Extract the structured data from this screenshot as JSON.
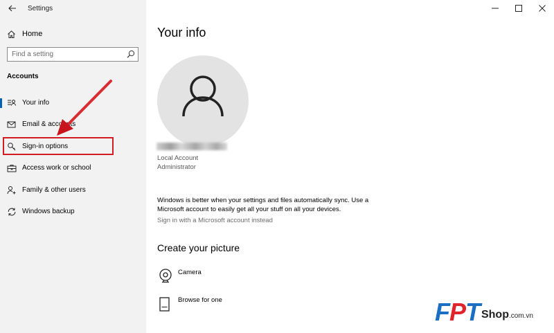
{
  "window": {
    "app_title": "Settings"
  },
  "sidebar": {
    "home_label": "Home",
    "search_placeholder": "Find a setting",
    "section_label": "Accounts",
    "items": [
      {
        "label": "Your info",
        "icon": "person-card-icon",
        "active": true
      },
      {
        "label": "Email & accounts",
        "icon": "mail-icon",
        "active": false
      },
      {
        "label": "Sign-in options",
        "icon": "key-icon",
        "active": false
      },
      {
        "label": "Access work or school",
        "icon": "briefcase-icon",
        "active": false
      },
      {
        "label": "Family & other users",
        "icon": "add-person-icon",
        "active": false
      },
      {
        "label": "Windows backup",
        "icon": "sync-icon",
        "active": false
      }
    ]
  },
  "main": {
    "title": "Your info",
    "account_type": "Local Account",
    "account_role": "Administrator",
    "sync_text": "Windows is better when your settings and files automatically sync. Use a Microsoft account to easily get all your stuff on all your devices.",
    "ms_link": "Sign in with a Microsoft account instead",
    "picture_heading": "Create your picture",
    "picture_options": [
      {
        "label": "Camera",
        "icon": "camera-icon"
      },
      {
        "label": "Browse for one",
        "icon": "browse-file-icon"
      }
    ]
  },
  "logo": {
    "fpt": "FPT",
    "shop": "Shop",
    "domain": ".com.vn"
  },
  "colors": {
    "sidebar_bg": "#f2f2f2",
    "accent": "#0063b1",
    "highlight_red": "#d21c22",
    "logo_blue": "#1a6fc2",
    "logo_red": "#e0242b"
  }
}
